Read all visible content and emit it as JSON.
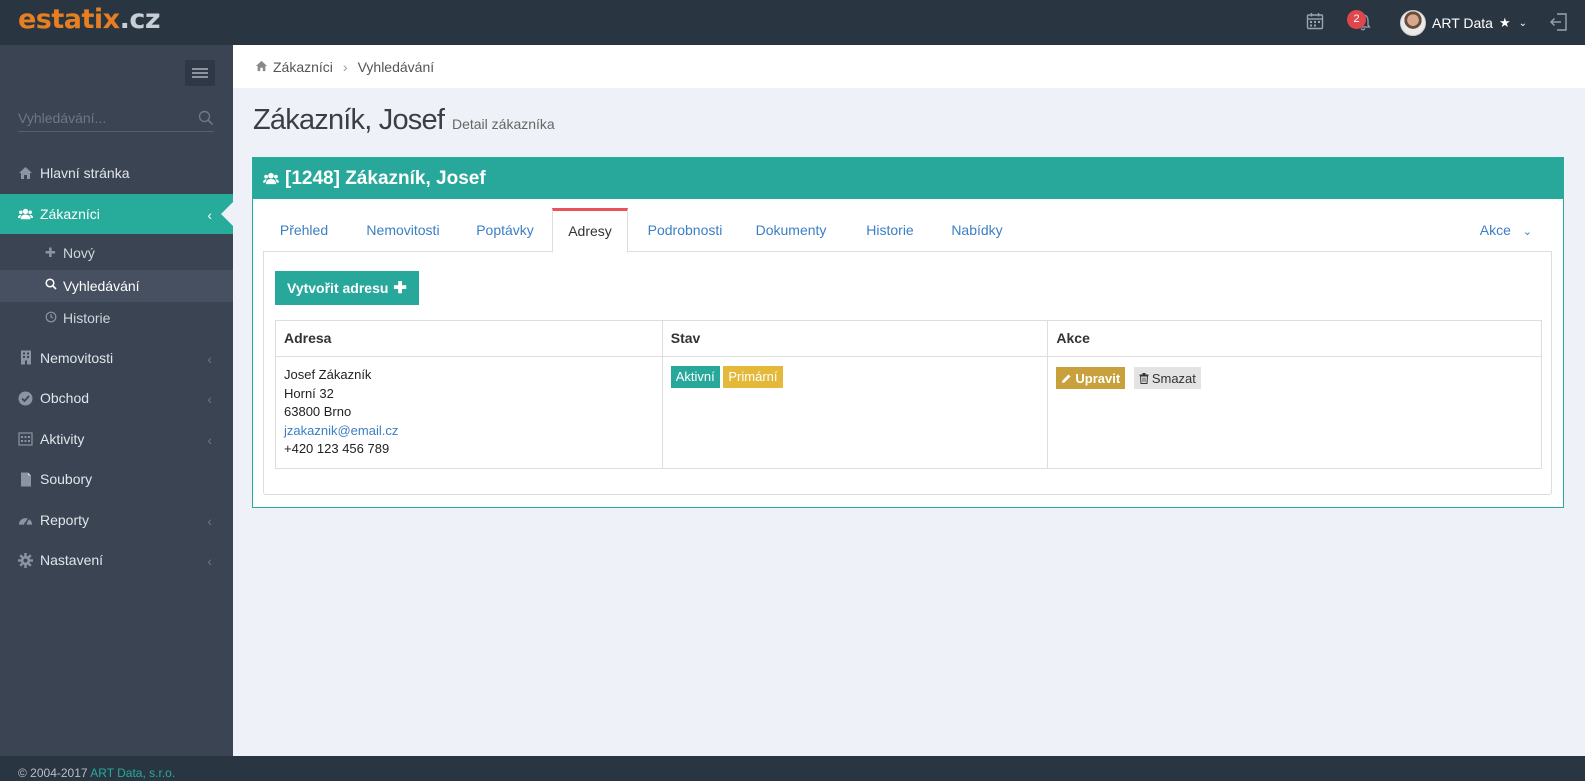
{
  "app": {
    "logo_brand": "estatix",
    "logo_tld": ".cz",
    "notifications_count": "2",
    "user_name": "ART Data",
    "user_star": "★",
    "user_caret": "⌄"
  },
  "sidebar": {
    "search_placeholder": "Vyhledávání...",
    "items": [
      {
        "label": "Hlavní stránka",
        "icon": "home-icon"
      },
      {
        "label": "Zákazníci",
        "icon": "users-icon",
        "active": true
      },
      {
        "label": "Nemovitosti",
        "icon": "building-icon"
      },
      {
        "label": "Obchod",
        "icon": "check-circle-icon"
      },
      {
        "label": "Aktivity",
        "icon": "calendar-icon"
      },
      {
        "label": "Soubory",
        "icon": "file-icon"
      },
      {
        "label": "Reporty",
        "icon": "dashboard-icon"
      },
      {
        "label": "Nastavení",
        "icon": "gear-icon"
      }
    ],
    "subitems": [
      {
        "label": "Nový",
        "icon": "plus-icon"
      },
      {
        "label": "Vyhledávání",
        "icon": "search-icon",
        "active": true
      },
      {
        "label": "Historie",
        "icon": "clock-icon"
      }
    ],
    "chevron": "‹"
  },
  "footer": {
    "copyright_prefix": "© 2004-2017",
    "copyright_company": "ART Data, s.r.o."
  },
  "breadcrumb": {
    "items": [
      "Zákazníci",
      "Vyhledávání"
    ],
    "separator": "›"
  },
  "page": {
    "title": "Zákazník, Josef",
    "subtitle": "Detail zákazníka"
  },
  "panel": {
    "heading": "[1248] Zákazník, Josef",
    "tabs": [
      "Přehled",
      "Nemovitosti",
      "Poptávky",
      "Adresy",
      "Podrobnosti",
      "Dokumenty",
      "Historie",
      "Nabídky"
    ],
    "active_tab": "Adresy",
    "actions_label": "Akce",
    "actions_caret": "⌄"
  },
  "addresses": {
    "create_button": "Vytvořit adresu",
    "create_plus": "✚",
    "columns": [
      "Adresa",
      "Stav",
      "Akce"
    ],
    "rows": [
      {
        "name": "Josef Zákazník",
        "street": "Horní 32",
        "city": "63800 Brno",
        "email": "jzakaznik@email.cz",
        "phone": "+420 123 456 789",
        "badges": [
          "Aktivní",
          "Primární"
        ],
        "edit_label": "Upravit",
        "delete_label": "Smazat"
      }
    ]
  },
  "colors": {
    "accent": "#27a89a",
    "topbar": "#2a3542",
    "sidebar": "#3a4452",
    "brand_orange": "#e67e22",
    "badge_yellow": "#e4b93a",
    "edit_button": "#c8a03c",
    "notification_red": "#e0474c",
    "active_tab_border": "#e8525a"
  }
}
